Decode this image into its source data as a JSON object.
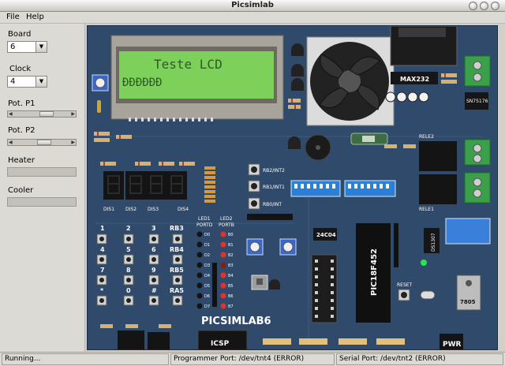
{
  "window": {
    "title": "Picsimlab"
  },
  "menu": {
    "file": "File",
    "help": "Help"
  },
  "panel": {
    "board_label": "Board",
    "board_value": "6",
    "clock_label": "Clock",
    "clock_value": "4",
    "pot1_label": "Pot. P1",
    "pot1_level": 0.55,
    "pot2_label": "Pot. P2",
    "pot2_level": 0.5,
    "heater_label": "Heater",
    "cooler_label": "Cooler"
  },
  "board": {
    "lcd_line1": "Teste LCD",
    "lcd_line2": "ÐÐÐÐÐÐ",
    "chip_label": "PIC18F452",
    "max232": "MAX232",
    "sn75176": "SN75176",
    "ds1307": "DS1307",
    "eeprom": "24C04",
    "regulator": "7805",
    "board_name": "PICSIMLAB6",
    "icsp": "ICSP",
    "pwr": "PWR",
    "reset": "RESET",
    "rele1": "RELE1",
    "rele2": "RELE2",
    "displays": [
      "DIS1",
      "DIS2",
      "DIS3",
      "DIS4"
    ],
    "led1_title": "LED1\nPORTD",
    "led2_title": "LED2\nPORTB",
    "portd_labels": [
      "D0",
      "D1",
      "D2",
      "D3",
      "D4",
      "D5",
      "D6",
      "D7"
    ],
    "portb_labels": [
      "B0",
      "B1",
      "B2",
      "B3",
      "B4",
      "B5",
      "B6",
      "B7"
    ],
    "buttons": [
      "RB2/INT2",
      "RB1/INT1",
      "RB0/INT"
    ],
    "keypad": [
      "1",
      "2",
      "3",
      "RB3",
      "4",
      "5",
      "6",
      "RB4",
      "7",
      "8",
      "9",
      "RB5",
      "*",
      "0",
      "#",
      "RA5"
    ]
  },
  "status": {
    "state": "Running...",
    "programmer": "Programmer Port: /dev/tnt4 (ERROR)",
    "serial": "Serial Port: /dev/tnt2 (ERROR)"
  }
}
